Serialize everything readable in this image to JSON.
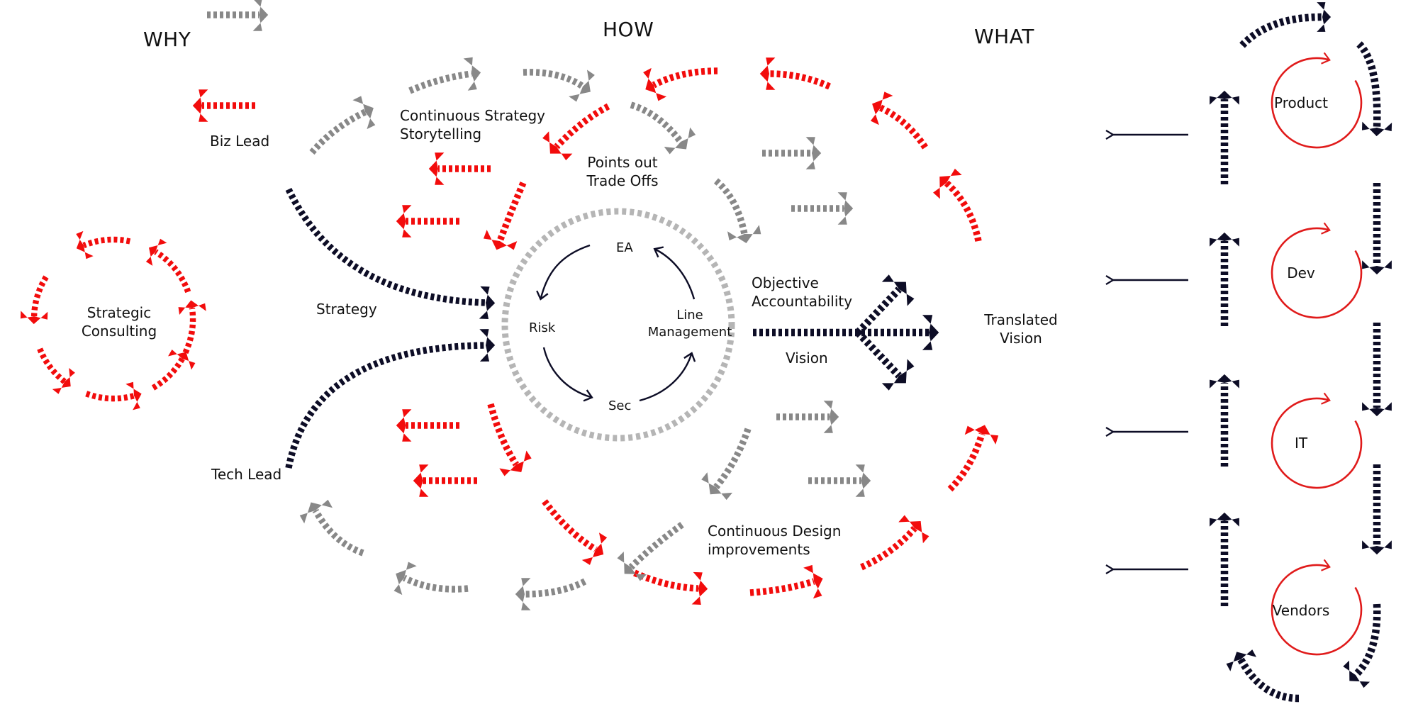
{
  "colors": {
    "red": "#f20c0c",
    "gray": "#888888",
    "light_gray": "#b5b5b5",
    "navy": "#0d0d26",
    "circle_red": "#e01b1b"
  },
  "headings": {
    "why": "WHY",
    "how": "HOW",
    "what": "WHAT"
  },
  "labels": {
    "biz_lead": "Biz Lead",
    "tech_lead": "Tech Lead",
    "strategy": "Strategy",
    "strategic_consulting": [
      "Strategic",
      "Consulting"
    ],
    "continuous_strategy": [
      "Continuous Strategy",
      "Storytelling"
    ],
    "points_out": [
      "Points out",
      "Trade Offs"
    ],
    "objective": [
      "Objective",
      "Accountability"
    ],
    "vision": "Vision",
    "translated_vision": [
      "Translated",
      "Vision"
    ],
    "continuous_design": [
      "Continuous Design",
      "improvements"
    ]
  },
  "inner_cycle": {
    "nodes": [
      "EA",
      "Risk",
      "Sec",
      "Line",
      "Management"
    ]
  },
  "teams": [
    {
      "label": "Product"
    },
    {
      "label": "Dev"
    },
    {
      "label": "IT"
    },
    {
      "label": "Vendors"
    }
  ]
}
